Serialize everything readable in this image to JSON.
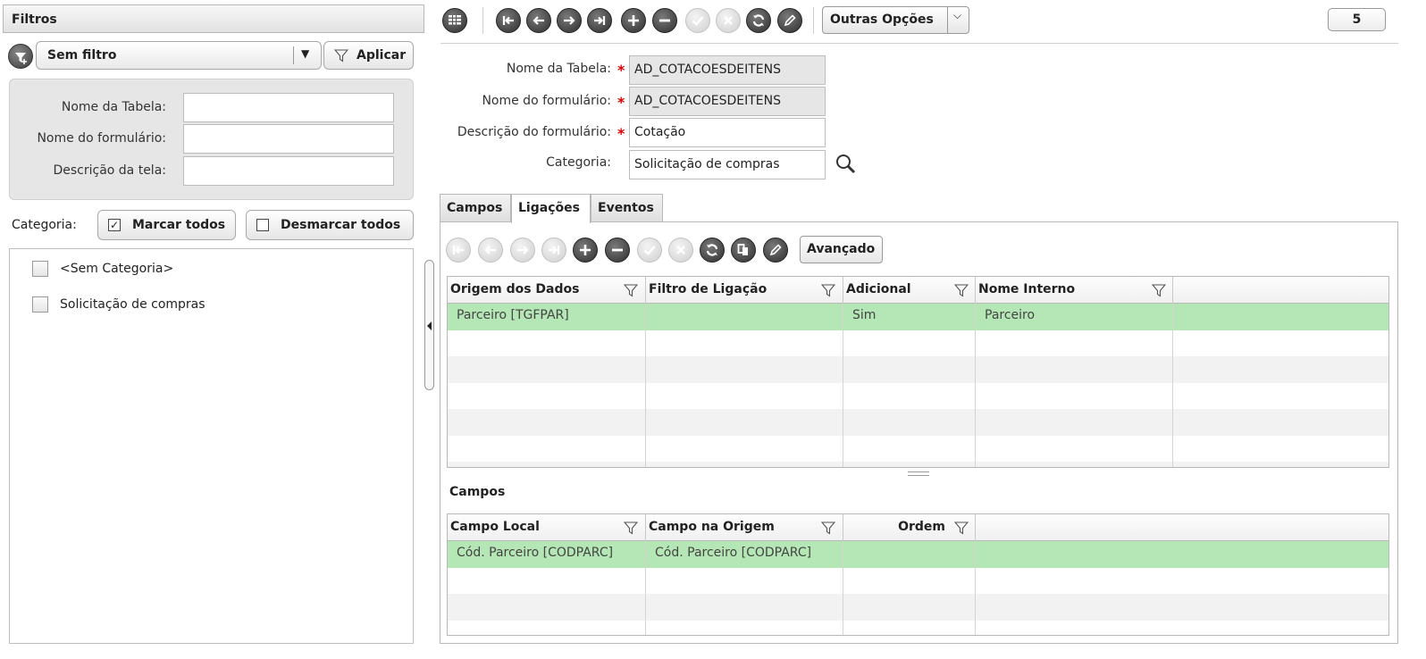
{
  "filters_panel": {
    "title": "Filtros",
    "select_value": "Sem filtro",
    "apply_label": "Aplicar",
    "fields": [
      {
        "label": "Nome da Tabela:",
        "value": ""
      },
      {
        "label": "Nome do formulário:",
        "value": ""
      },
      {
        "label": "Descrição da tela:",
        "value": ""
      }
    ],
    "category_label": "Categoria:",
    "mark_all_label": "Marcar todos",
    "unmark_all_label": "Desmarcar todos",
    "categories": [
      {
        "label": "<Sem Categoria>",
        "checked": false
      },
      {
        "label": "Solicitação de compras",
        "checked": false
      }
    ]
  },
  "toolbar": {
    "more_options_label": "Outras Opções",
    "counter": "5",
    "icons": [
      "grid-icon",
      "first-icon",
      "previous-icon",
      "next-icon",
      "last-icon",
      "add-icon",
      "remove-icon",
      "confirm-icon",
      "cancel-icon",
      "refresh-icon",
      "edit-icon"
    ]
  },
  "form": {
    "table_name_label": "Nome da Tabela:",
    "table_name_value": "AD_COTACOESDEITENS",
    "form_name_label": "Nome do formulário:",
    "form_name_value": "AD_COTACOESDEITENS",
    "form_desc_label": "Descrição do formulário:",
    "form_desc_value": "Cotação",
    "category_label": "Categoria:",
    "category_value": "Solicitação de compras"
  },
  "tabs": [
    {
      "label": "Campos",
      "active": false
    },
    {
      "label": "Ligações",
      "active": true
    },
    {
      "label": "Eventos",
      "active": false
    }
  ],
  "links_toolbar": {
    "advanced_label": "Avançado"
  },
  "links_grid": {
    "columns": [
      "Origem dos Dados",
      "Filtro de Ligação",
      "Adicional",
      "Nome Interno"
    ],
    "rows": [
      [
        "Parceiro [TGFPAR]",
        "",
        "Sim",
        "Parceiro"
      ]
    ]
  },
  "fields_section": {
    "title": "Campos",
    "columns": [
      "Campo Local",
      "Campo na Origem",
      "Ordem"
    ],
    "rows": [
      [
        "Cód. Parceiro [CODPARC]",
        "Cód. Parceiro [CODPARC]",
        ""
      ]
    ]
  },
  "colors": {
    "selected_row": "#b5e6b5",
    "required_mark": "#dd0000",
    "readonly_bg": "#e6e6e6"
  }
}
